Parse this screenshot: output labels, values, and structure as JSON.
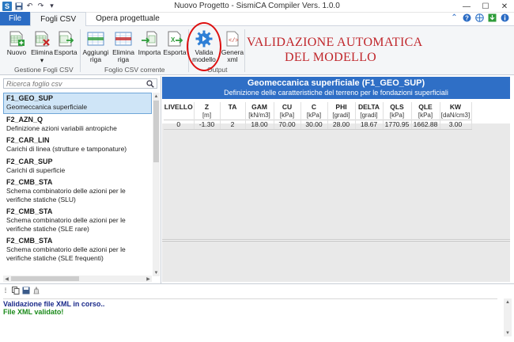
{
  "window": {
    "title": "Nuovo Progetto - SismiCA Compiler Vers. 1.0.0",
    "controls": [
      "minimize",
      "maximize",
      "close"
    ]
  },
  "quick_access": [
    "save-icon",
    "undo-icon",
    "redo-icon",
    "customize-icon"
  ],
  "tabs": [
    {
      "label": "File"
    },
    {
      "label": "Fogli CSV"
    },
    {
      "label": "Opera progettuale"
    }
  ],
  "ribbon": {
    "buttons": {
      "nuovo": "Nuovo",
      "elimina": "Elimina",
      "esporta": "Esporta",
      "aggiungi_riga": "Aggiungi riga",
      "elimina_riga": "Elimina riga",
      "importa": "Importa",
      "esporta2": "Esporta",
      "valida_modello": "Valida modello",
      "genera_xml": "Genera xml"
    },
    "groups": {
      "gestione": "Gestione Fogli CSV",
      "corrente": "Foglio CSV corrente",
      "output": "Output"
    },
    "annotation_line1": "VALIDAZIONE AUTOMATICA",
    "annotation_line2": "DEL MODELLO"
  },
  "search": {
    "placeholder": "Ricerca foglio csv"
  },
  "csv_list": [
    {
      "code": "F1_GEO_SUP",
      "desc": "Geomeccanica superficiale",
      "selected": true
    },
    {
      "code": "F2_AZN_Q",
      "desc": "Definizione azioni variabili antropiche"
    },
    {
      "code": "F2_CAR_LIN",
      "desc": "Carichi di linea (strutture e tamponature)"
    },
    {
      "code": "F2_CAR_SUP",
      "desc": "Carichi di superficie"
    },
    {
      "code": "F2_CMB_STA",
      "desc": "Schema combinatorio delle azioni per le verifiche statiche (SLU)"
    },
    {
      "code": "F2_CMB_STA",
      "desc": "Schema combinatorio delle azioni per le verifiche statiche (SLE rare)"
    },
    {
      "code": "F2_CMB_STA",
      "desc": "Schema combinatorio delle azioni per le verifiche statiche (SLE frequenti)"
    }
  ],
  "sheet": {
    "title": "Geomeccanica superficiale (F1_GEO_SUP)",
    "subtitle": "Definizione delle caratteristiche del terreno per le fondazioni superficiali",
    "columns": [
      {
        "name": "LIVELLO",
        "unit": ""
      },
      {
        "name": "Z",
        "unit": "[m]"
      },
      {
        "name": "TA",
        "unit": ""
      },
      {
        "name": "GAM",
        "unit": "[kN/m3]"
      },
      {
        "name": "CU",
        "unit": "[kPa]"
      },
      {
        "name": "C",
        "unit": "[kPa]"
      },
      {
        "name": "PHI",
        "unit": "[gradi]"
      },
      {
        "name": "DELTA",
        "unit": "[gradi]"
      },
      {
        "name": "QLS",
        "unit": "[kPa]"
      },
      {
        "name": "QLE",
        "unit": "[kPa]"
      },
      {
        "name": "KW",
        "unit": "[daN/cm3]"
      }
    ],
    "rows": [
      [
        "0",
        "-1.30",
        "2",
        "18.00",
        "70.00",
        "30.00",
        "28.00",
        "18.67",
        "1770.95",
        "1662.88",
        "3.00"
      ]
    ]
  },
  "log": {
    "tools": [
      "copy-icon",
      "save-icon",
      "clear-icon"
    ],
    "lines": [
      {
        "text": "Validazione file XML in corso..",
        "color": "#1a2a8a"
      },
      {
        "text": "File XML validato!",
        "color": "#1a8a1a"
      }
    ]
  },
  "colors": {
    "accent": "#2b6cc4",
    "header_blue": "#2f6fc6",
    "annotation_red": "#c0262b"
  }
}
